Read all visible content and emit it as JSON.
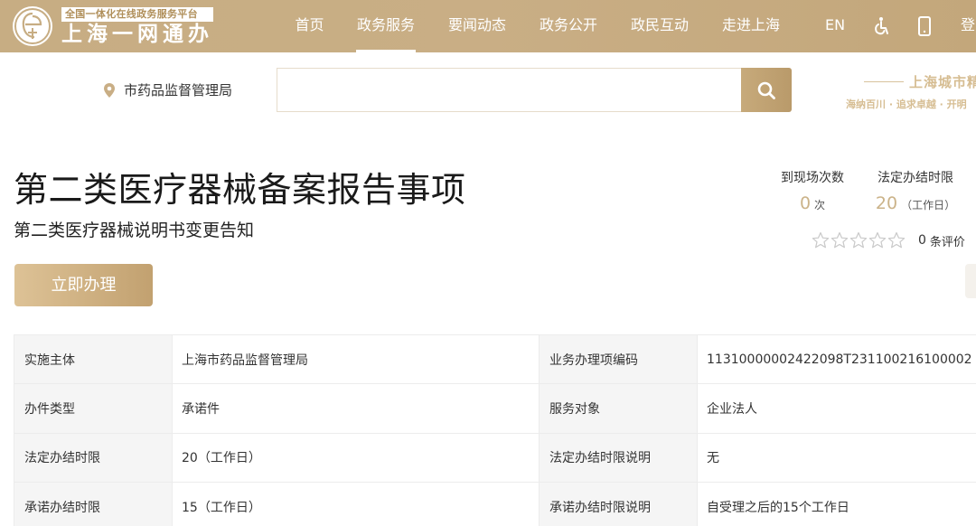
{
  "header": {
    "logo_tagline": "全国一体化在线政务服务平台",
    "logo_name": "上海一网通办",
    "logo_icon": "shanghai-emblem-icon",
    "nav": [
      {
        "label": "首页",
        "active": false
      },
      {
        "label": "政务服务",
        "active": true
      },
      {
        "label": "要闻动态",
        "active": false
      },
      {
        "label": "政务公开",
        "active": false
      },
      {
        "label": "政民互动",
        "active": false
      },
      {
        "label": "走进上海",
        "active": false
      }
    ],
    "lang": "EN",
    "accessibility_icon": "accessibility-icon",
    "mobile_icon": "mobile-phone-icon",
    "login_label": "登"
  },
  "search": {
    "location": "市药品监督管理局",
    "location_icon": "map-pin-icon",
    "value": "",
    "placeholder": "",
    "button_icon": "search-icon"
  },
  "promo": {
    "title": "上海城市精",
    "subtitle": "海纳百川 · 追求卓越 · 开明"
  },
  "item": {
    "title": "第二类医疗器械备案报告事项",
    "subtitle": "第二类医疗器械说明书变更告知",
    "apply_label": "立即办理"
  },
  "stats": {
    "visits_label": "到现场次数",
    "visits_value": "0",
    "visits_unit": "次",
    "limit_label": "法定办结时限",
    "limit_value": "20",
    "limit_unit": "（工作日）",
    "rating_stars": 0,
    "rating_max": 5,
    "rating_count": "0",
    "rating_unit": "条评价"
  },
  "table": {
    "rows": [
      [
        "实施主体",
        "上海市药品监督管理局",
        "业务办理项编码",
        "11310000002422098T231100216100002"
      ],
      [
        "办件类型",
        "承诺件",
        "服务对象",
        "企业法人"
      ],
      [
        "法定办结时限",
        "20（工作日）",
        "法定办结时限说明",
        "无"
      ],
      [
        "承诺办结时限",
        "15（工作日）",
        "承诺办结时限说明",
        "自受理之后的15个工作日"
      ]
    ]
  },
  "colors": {
    "brand": "#c7ad83",
    "accent_text": "#cbb389",
    "table_key_bg": "#f5f5f5"
  }
}
